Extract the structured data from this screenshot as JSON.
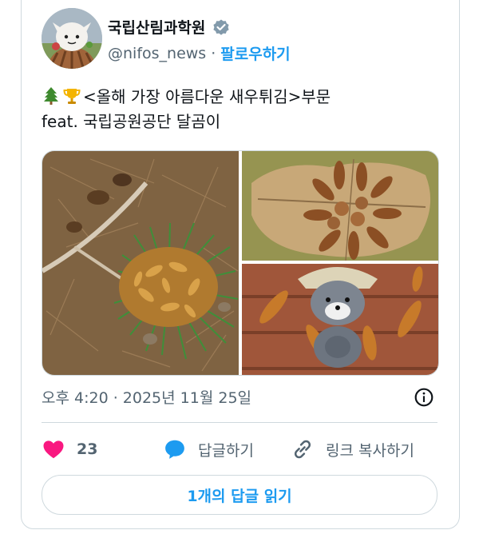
{
  "account": {
    "name": "국립산림과학원",
    "handle": "@nifos_news",
    "separator": "·",
    "follow_label": "팔로우하기",
    "avatar_icon": "mascot-avatar-icon",
    "verified_color": "#829aab"
  },
  "tweet": {
    "line1_text": "<올해 가장 아름다운 새우튀김>부문",
    "line2_text": "feat. 국립공원공단 달곰이",
    "emojis": [
      "evergreen-tree-icon",
      "trophy-icon"
    ]
  },
  "media": {
    "images": [
      {
        "name": "photo-pine-needles-cones"
      },
      {
        "name": "photo-cones-on-leaf"
      },
      {
        "name": "photo-bear-plush-cones"
      }
    ]
  },
  "meta": {
    "timestamp": "오후 4:20 · 2025년 11월 25일"
  },
  "actions": {
    "like_count": "23",
    "reply_label": "답글하기",
    "copy_link_label": "링크 복사하기"
  },
  "read_replies_label": "1개의 답글 읽기",
  "colors": {
    "accent": "#1d9bf0",
    "like": "#f91880",
    "secondary_text": "#536471",
    "border": "#cfd9de"
  }
}
